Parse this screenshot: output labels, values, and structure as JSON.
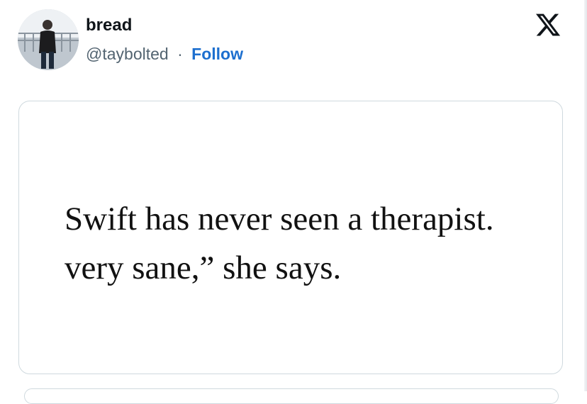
{
  "author": {
    "display_name": "bread",
    "handle": "@taybolted",
    "separator": "·",
    "follow_label": "Follow",
    "avatar_icon": "profile-photo"
  },
  "platform": {
    "logo_icon": "x-logo-icon"
  },
  "media": {
    "quote_line_1": "Swift has never seen a therapist.",
    "quote_line_2": "very sane,” she says."
  },
  "colors": {
    "follow": "#1d6fcf",
    "handle": "#536471",
    "name": "#0f1419",
    "card_border": "#cfd9de"
  }
}
